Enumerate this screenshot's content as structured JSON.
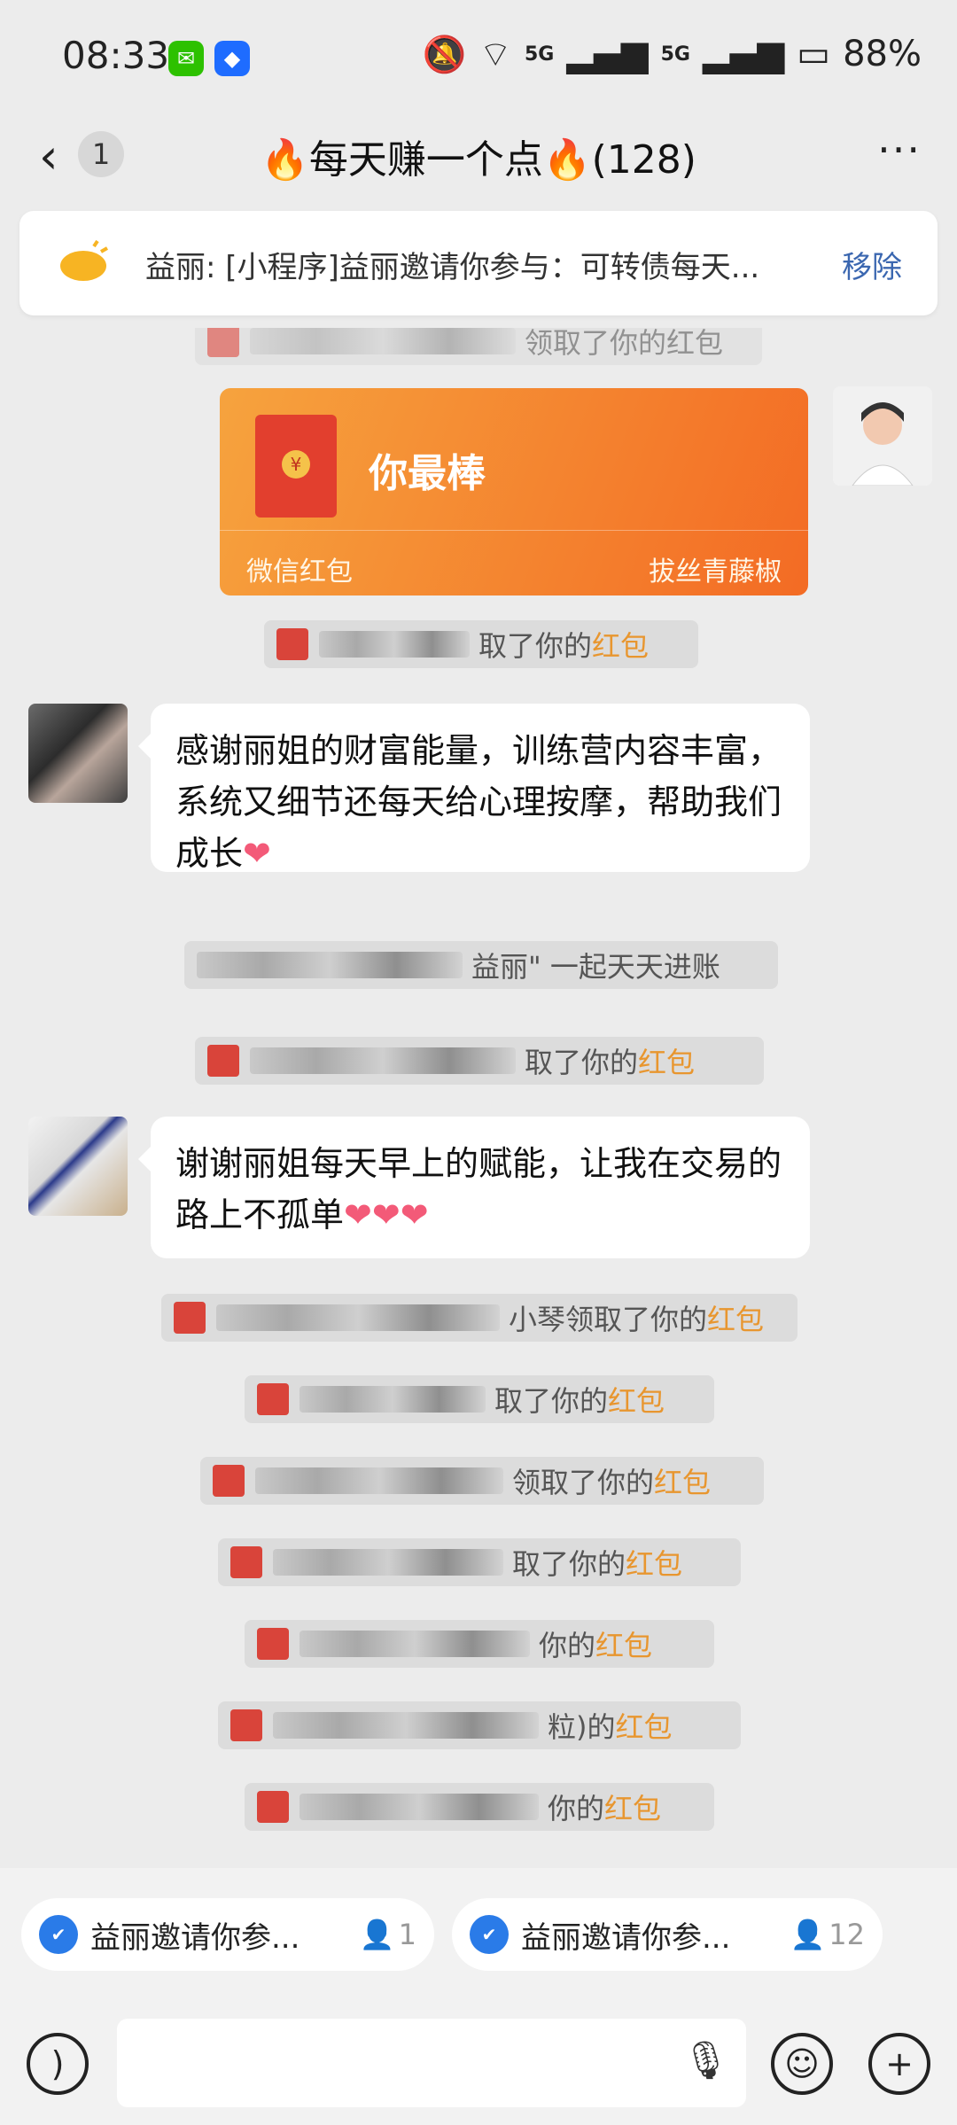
{
  "status_bar": {
    "time": "08:33",
    "battery": "88%",
    "network1": "5G",
    "network2": "5G"
  },
  "header": {
    "unread_count": "1",
    "title": "🔥每天赚一个点🔥(128)",
    "more": "···"
  },
  "notice": {
    "text": "益丽: [小程序]益丽邀请你参与：可转债每天...",
    "remove_label": "移除"
  },
  "chat": {
    "top_partial": "领取了你的红包",
    "red_packet": {
      "greeting": "你最棒",
      "type_label": "微信红包",
      "sender_label": "拔丝青藤椒"
    },
    "sys1_suffix": "取了你的",
    "msg1": "感谢丽姐的财富能量，训练营内容丰富，系统又细节还每天给心理按摩，帮助我们成长",
    "msg1_emoji": "❤",
    "sys2_suffix": "益丽\" 一起天天进账",
    "sys3_suffix": "取了你的",
    "msg2": "谢谢丽姐每天早上的赋能，让我在交易的路上不孤单",
    "msg2_emoji": "❤❤❤",
    "claims": [
      {
        "suffix": "小琴领取了你的"
      },
      {
        "suffix": "取了你的"
      },
      {
        "suffix": "领取了你的"
      },
      {
        "suffix": "取了你的"
      },
      {
        "suffix": "你的"
      },
      {
        "suffix": "粒)的"
      },
      {
        "suffix": "你的"
      }
    ],
    "red_packet_word": "红包"
  },
  "chips": [
    {
      "label": "益丽邀请你参...",
      "count": "1"
    },
    {
      "label": "益丽邀请你参...",
      "count": "12"
    }
  ],
  "colors": {
    "background": "#ececec",
    "red_packet_start": "#f6a33e",
    "red_packet_end": "#f36b24",
    "red_packet_word": "#e8962f",
    "remove_link": "#3b67b0"
  }
}
